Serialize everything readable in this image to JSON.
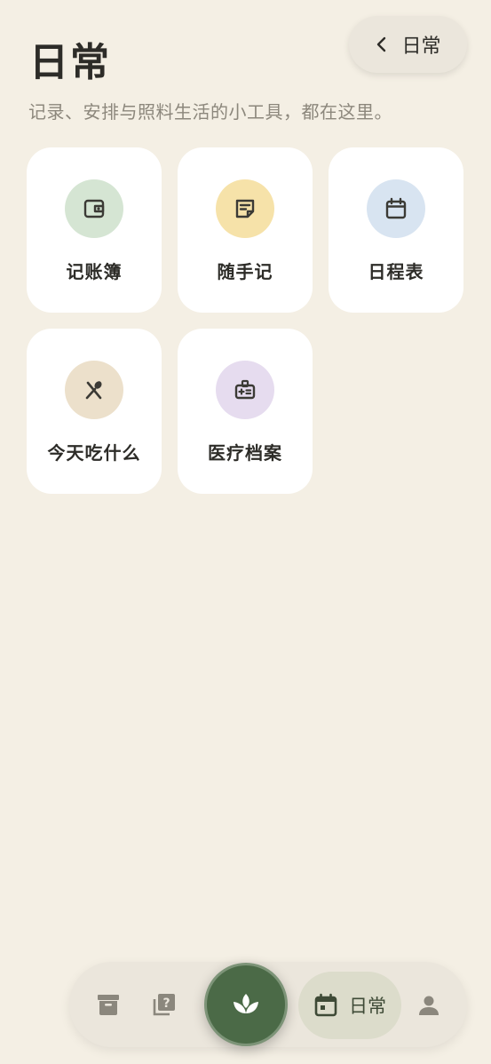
{
  "header": {
    "title": "日常",
    "back_label": "日常",
    "subtitle": "记录、安排与照料生活的小工具，都在这里。"
  },
  "tools": [
    {
      "label": "记账簿",
      "icon": "wallet-icon",
      "color": "#d5e5d3"
    },
    {
      "label": "随手记",
      "icon": "note-icon",
      "color": "#f6e2a9"
    },
    {
      "label": "日程表",
      "icon": "calendar-icon",
      "color": "#d8e4f1"
    },
    {
      "label": "今天吃什么",
      "icon": "fork-spoon-icon",
      "color": "#ece0cb"
    },
    {
      "label": "医疗档案",
      "icon": "medical-kit-icon",
      "color": "#e6dcef"
    }
  ],
  "nav": {
    "items": [
      {
        "icon": "archive-icon"
      },
      {
        "icon": "question-library-icon"
      },
      {
        "icon": "sprout-icon"
      },
      {
        "icon": "calendar-icon",
        "label": "日常",
        "active": true
      },
      {
        "icon": "person-icon"
      }
    ]
  },
  "colors": {
    "background": "#f4efe4",
    "accent": "#4b6a47",
    "active_pill": "#dcdccb"
  }
}
